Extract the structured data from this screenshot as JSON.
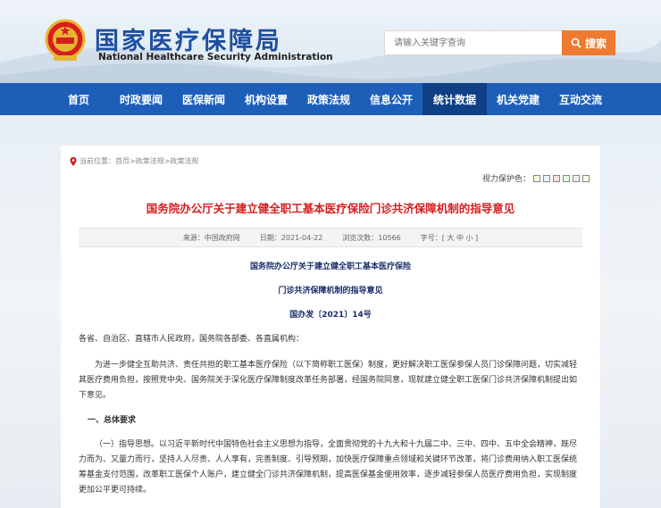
{
  "site": {
    "name_cn": "国家医疗保障局",
    "name_en": "National Healthcare Security Administration"
  },
  "search": {
    "placeholder": "请输入关键字查询",
    "button_label": "搜索"
  },
  "nav": {
    "items": [
      "首页",
      "时政要闻",
      "医保新闻",
      "机构设置",
      "政策法规",
      "信息公开",
      "统计数据",
      "机关党建",
      "互动交流"
    ],
    "active_index": 6
  },
  "breadcrumb": {
    "label": "当前位置：",
    "path": "首页>政策法规>政策法规"
  },
  "vision": {
    "label": "视力保护色：",
    "colors": [
      "#ffffe0",
      "#e6f2ff",
      "#ffe0e0",
      "#e0ffe0",
      "#f0f0f0",
      "#fff8dc"
    ]
  },
  "article": {
    "title": "国务院办公厅关于建立健全职工基本医疗保险门诊共济保障机制的指导意见",
    "meta": {
      "source": "来源：中国政府网",
      "date": "日期：2021-04-22",
      "views_label": "浏览次数：",
      "views": "10566",
      "font_size": "字号：[ 大 中 小 ]"
    },
    "doc_title_1": "国务院办公厅关于建立健全职工基本医疗保险",
    "doc_title_2": "门诊共济保障机制的指导意见",
    "doc_number": "国办发〔2021〕14号",
    "addressee": "各省、自治区、直辖市人民政府，国务院各部委、各直属机构：",
    "intro": "为进一步健全互助共济、责任共担的职工基本医疗保险（以下简称职工医保）制度，更好解决职工医保参保人员门诊保障问题，切实减轻其医疗费用负担，按照党中央、国务院关于深化医疗保障制度改革任务部署，经国务院同意，现就建立健全职工医保门诊共济保障机制提出如下意见。",
    "section_1": "一、总体要求",
    "para_1": "（一）指导思想。以习近平新时代中国特色社会主义思想为指导，全面贯彻党的十九大和十九届二中、三中、四中、五中全会精神，既尽力而为、又量力而行，坚持人人尽责、人人享有，完善制度、引导预期，加快医疗保障重点领域和关键环节改革，将门诊费用纳入职工医保统筹基金支付范围，改革职工医保个人账户，建立健全门诊共济保障机制，提高医保基金使用效率，逐步减轻参保人员医疗费用负担，实现制度更加公平更可持续。"
  }
}
